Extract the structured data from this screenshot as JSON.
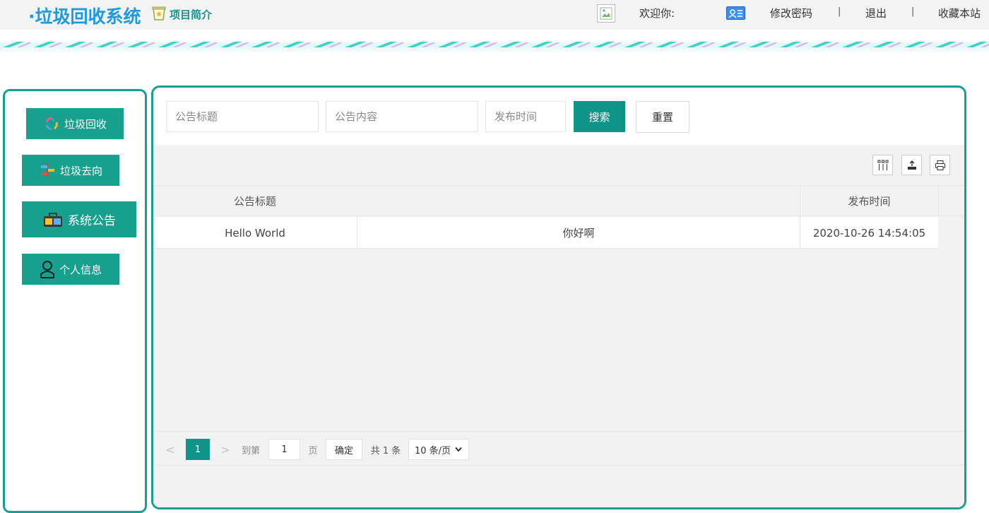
{
  "header": {
    "logo": "·垃圾回收系统",
    "intro_label": "项目简介",
    "welcome": "欢迎你:",
    "change_password": "修改密码",
    "separator": "|",
    "logout": "退出",
    "bookmark": "收藏本站"
  },
  "sidebar": {
    "items": [
      {
        "label": "垃圾回收",
        "icon": "recycle-icon"
      },
      {
        "label": "垃圾去向",
        "icon": "signpost-icon"
      },
      {
        "label": "系统公告",
        "icon": "briefcase-icon"
      },
      {
        "label": "个人信息",
        "icon": "user-icon"
      }
    ]
  },
  "search": {
    "title_placeholder": "公告标题",
    "content_placeholder": "公告内容",
    "time_placeholder": "发布时间",
    "search_label": "搜索",
    "reset_label": "重置"
  },
  "table": {
    "columns": [
      "公告标题",
      "发布时间"
    ],
    "rows": [
      {
        "title": "Hello World",
        "content": "你好啊",
        "time": "2020-10-26 14:54:05"
      }
    ]
  },
  "pagination": {
    "prev": "<",
    "current_page": "1",
    "next": ">",
    "goto_prefix": "到第",
    "goto_value": "1",
    "goto_suffix": "页",
    "confirm": "确定",
    "total": "共 1 条",
    "page_size": "10 条/页"
  },
  "colors": {
    "brand": "#17a08e",
    "logo": "#1e9ae0"
  }
}
